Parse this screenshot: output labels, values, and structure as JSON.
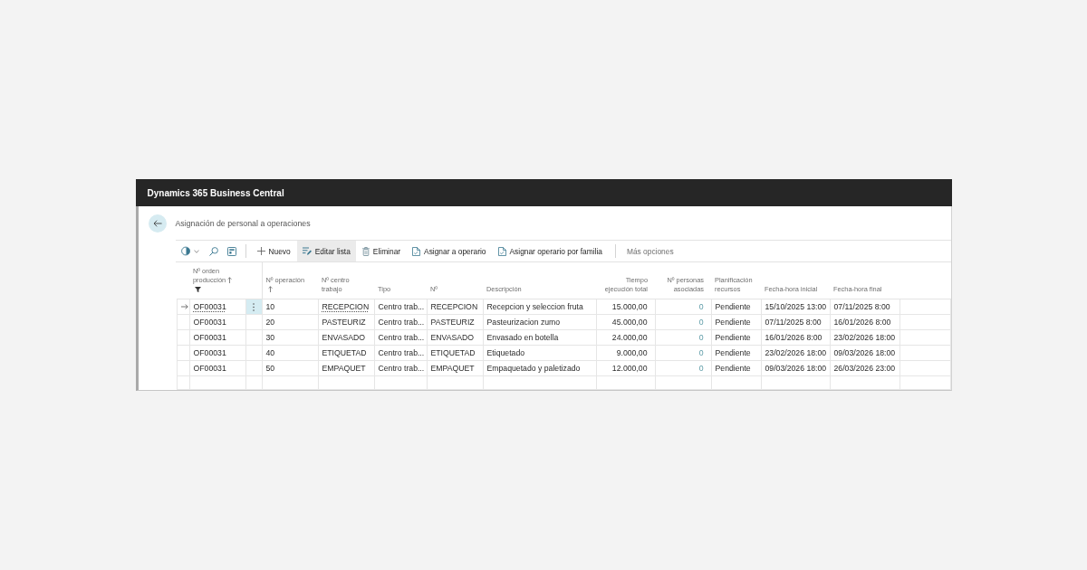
{
  "app_bar": {
    "title": "Dynamics 365 Business Central"
  },
  "page": {
    "title": "Asignación de personal a operaciones"
  },
  "toolbar": {
    "actions": [
      {
        "kind": "add",
        "label": "Nuevo",
        "highlighted": false
      },
      {
        "kind": "edit",
        "label": "Editar lista",
        "highlighted": true
      },
      {
        "kind": "delete",
        "label": "Eliminar",
        "highlighted": false
      },
      {
        "kind": "document",
        "label": "Asignar a operario",
        "highlighted": false
      },
      {
        "kind": "document",
        "label": "Asignar operario por familia",
        "highlighted": false
      }
    ],
    "more": {
      "label": "Más opciones"
    }
  },
  "table": {
    "columns": [
      {
        "label": "Nº orden producción",
        "kind": "link",
        "sorted": true,
        "filtered": true
      },
      {
        "label": "Nº operación",
        "kind": "text",
        "sorted": true,
        "filtered": false
      },
      {
        "label": "Nº centro trabajo",
        "kind": "link",
        "sorted": false,
        "filtered": false
      },
      {
        "label": "Tipo",
        "kind": "text",
        "sorted": false,
        "filtered": false
      },
      {
        "label": "Nº",
        "kind": "text",
        "sorted": false,
        "filtered": false
      },
      {
        "label": "Descripción",
        "kind": "text",
        "sorted": false,
        "filtered": false
      },
      {
        "label": "Tiempo ejecución total",
        "kind": "number",
        "sorted": false,
        "filtered": false
      },
      {
        "label": "Nº personas asociadas",
        "kind": "drilldown",
        "sorted": false,
        "filtered": false
      },
      {
        "label": "Planificación recursos",
        "kind": "text",
        "sorted": false,
        "filtered": false
      },
      {
        "label": "Fecha-hora inicial",
        "kind": "text",
        "sorted": false,
        "filtered": false
      },
      {
        "label": "Fecha-hora final",
        "kind": "text",
        "sorted": false,
        "filtered": false
      }
    ],
    "rows": [
      {
        "current": true,
        "cells": [
          "OF00031",
          "10",
          "RECEPCION",
          "Centro trab...",
          "RECEPCION",
          "Recepcion y seleccion fruta",
          "15.000,00",
          "0",
          "Pendiente",
          "15/10/2025 13:00",
          "07/11/2025 8:00"
        ]
      },
      {
        "current": false,
        "cells": [
          "OF00031",
          "20",
          "PASTEURIZ",
          "Centro trab...",
          "PASTEURIZ",
          "Pasteurizacion zumo",
          "45.000,00",
          "0",
          "Pendiente",
          "07/11/2025 8:00",
          "16/01/2026 8:00"
        ]
      },
      {
        "current": false,
        "cells": [
          "OF00031",
          "30",
          "ENVASADO",
          "Centro trab...",
          "ENVASADO",
          "Envasado en botella",
          "24.000,00",
          "0",
          "Pendiente",
          "16/01/2026 8:00",
          "23/02/2026 18:00"
        ]
      },
      {
        "current": false,
        "cells": [
          "OF00031",
          "40",
          "ETIQUETAD",
          "Centro trab...",
          "ETIQUETAD",
          "Etiquetado",
          "9.000,00",
          "0",
          "Pendiente",
          "23/02/2026 18:00",
          "09/03/2026 18:00"
        ]
      },
      {
        "current": false,
        "cells": [
          "OF00031",
          "50",
          "EMPAQUET",
          "Centro trab...",
          "EMPAQUET",
          "Empaquetado y paletizado",
          "12.000,00",
          "0",
          "Pendiente",
          "09/03/2026 18:00",
          "26/03/2026 23:00"
        ]
      }
    ]
  }
}
